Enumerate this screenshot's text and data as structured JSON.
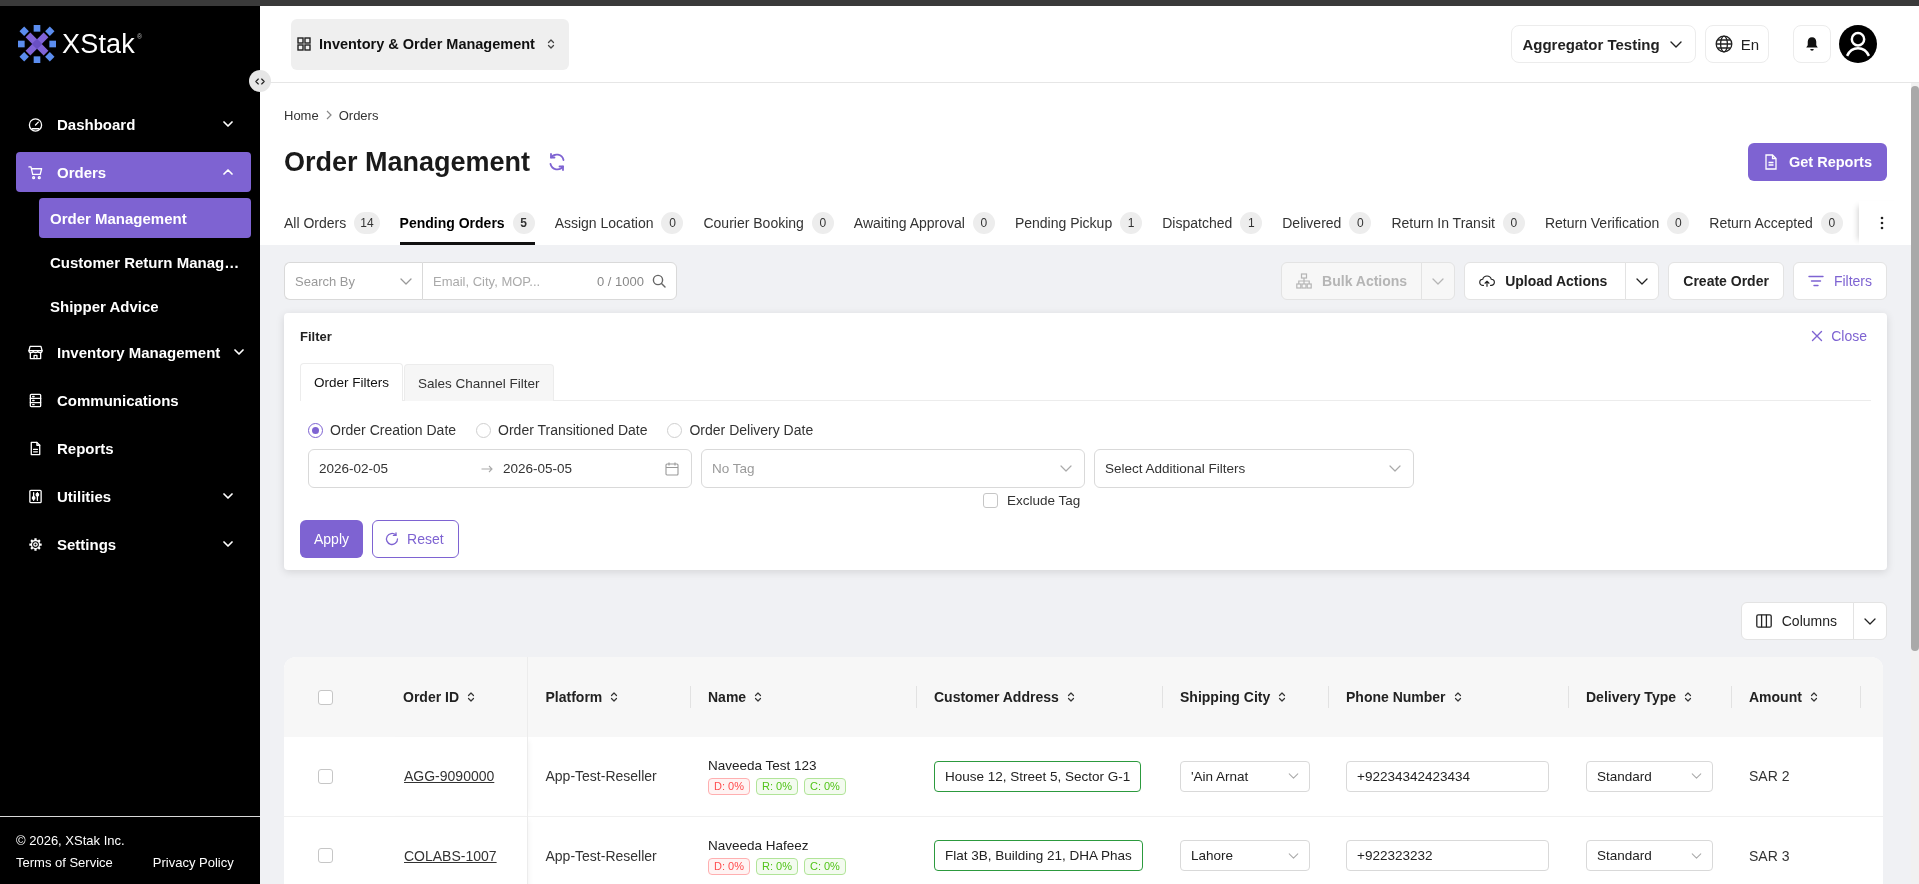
{
  "sidebar": {
    "logo": "XStak$^{®}$",
    "items": [
      {
        "label": "Dashboard",
        "expanded": false,
        "selected": false
      },
      {
        "label": "Orders",
        "expanded": true,
        "selected": true,
        "children": [
          {
            "label": "Order Management",
            "selected": true
          },
          {
            "label": "Customer Return Manag…",
            "selected": false
          },
          {
            "label": "Shipper Advice",
            "selected": false
          }
        ]
      },
      {
        "label": "Inventory Management",
        "expanded": false,
        "selected": false
      },
      {
        "label": "Communications",
        "selected": false
      },
      {
        "label": "Reports",
        "selected": false
      },
      {
        "label": "Utilities",
        "expanded": false,
        "selected": false
      },
      {
        "label": "Settings",
        "expanded": false,
        "selected": false
      }
    ],
    "footer": {
      "copyright": "© 2026, XStak Inc.",
      "links": [
        "Terms of Service",
        "Privacy Policy"
      ]
    }
  },
  "header": {
    "module_switcher": "Inventory & Order Management",
    "account": "Aggregator Testing",
    "language": "En"
  },
  "page": {
    "breadcrumb": [
      "Home",
      "Orders"
    ],
    "title": "Order Management",
    "get_reports": "Get Reports"
  },
  "tabs": [
    {
      "label": "All Orders",
      "count": "14",
      "selected": false
    },
    {
      "label": "Pending Orders",
      "count": "5",
      "selected": true
    },
    {
      "label": "Assign Location",
      "count": "0",
      "selected": false
    },
    {
      "label": "Courier Booking",
      "count": "0",
      "selected": false
    },
    {
      "label": "Awaiting Approval",
      "count": "0",
      "selected": false
    },
    {
      "label": "Pending Pickup",
      "count": "1",
      "selected": false
    },
    {
      "label": "Dispatched",
      "count": "1",
      "selected": false
    },
    {
      "label": "Delivered",
      "count": "0",
      "selected": false
    },
    {
      "label": "Return In Transit",
      "count": "0",
      "selected": false
    },
    {
      "label": "Return Verification",
      "count": "0",
      "selected": false
    },
    {
      "label": "Return Accepted",
      "count": "0",
      "selected": false
    }
  ],
  "toolbar": {
    "search_by": {
      "placeholder": "Search By"
    },
    "search": {
      "placeholder": "Email, City, MOP...",
      "counter": "0 / 1000"
    },
    "bulk_actions": {
      "label": "Bulk Actions",
      "disabled": true
    },
    "upload_actions": {
      "label": "Upload Actions",
      "disabled": false
    },
    "create_order": "Create Order",
    "filters": {
      "label": "Filters",
      "active": true
    }
  },
  "filter_panel": {
    "title": "Filter",
    "close": "Close",
    "tabs": [
      {
        "label": "Order Filters",
        "selected": true
      },
      {
        "label": "Sales Channel Filter",
        "selected": false
      }
    ],
    "date_types": [
      {
        "label": "Order Creation Date",
        "selected": true
      },
      {
        "label": "Order Transitioned Date",
        "selected": false
      },
      {
        "label": "Order Delivery Date",
        "selected": false
      }
    ],
    "date_range": {
      "from": "2026-02-05",
      "to": "2026-05-05"
    },
    "tag_select": {
      "placeholder": "No Tag"
    },
    "additional_filters": {
      "label": "Select Additional Filters"
    },
    "exclude_tag": {
      "label": "Exclude Tag",
      "checked": false
    },
    "apply": "Apply",
    "reset": "Reset"
  },
  "columns_button": "Columns",
  "table": {
    "select_all": {
      "checked": false
    },
    "columns": [
      {
        "label": "Order ID",
        "sortable": true
      },
      {
        "label": "Platform",
        "sortable": true
      },
      {
        "label": "Name",
        "sortable": true
      },
      {
        "label": "Customer Address",
        "sortable": true
      },
      {
        "label": "Shipping City",
        "sortable": true
      },
      {
        "label": "Phone Number",
        "sortable": true
      },
      {
        "label": "Delivery Type",
        "sortable": true
      },
      {
        "label": "Amount",
        "sortable": true
      }
    ],
    "rows": [
      {
        "checked": false,
        "order_id": "AGG-9090000",
        "platform": "App-Test-Reseller",
        "name": "Naveeda Test 123",
        "badges": [
          {
            "label": "D: 0%",
            "color": "#ff4d4f"
          },
          {
            "label": "R: 0%",
            "color": "#52c41a"
          },
          {
            "label": "C: 0%",
            "color": "#52c41a"
          }
        ],
        "address": "House 12, Street 5, Sector G-1",
        "city": "'Ain Arnat",
        "phone": "+92234342423434",
        "delivery_type": "Standard",
        "amount": "SAR 2"
      },
      {
        "checked": false,
        "order_id": "COLABS-1007",
        "platform": "App-Test-Reseller",
        "name": "Naveeda Hafeez",
        "badges": [
          {
            "label": "D: 0%",
            "color": "#ff4d4f"
          },
          {
            "label": "R: 0%",
            "color": "#52c41a"
          },
          {
            "label": "C: 0%",
            "color": "#52c41a"
          }
        ],
        "address": "Flat 3B, Building 21, DHA Phas",
        "city": "Lahore",
        "phone": "+922323232",
        "delivery_type": "Standard",
        "amount": "SAR 3"
      }
    ]
  }
}
